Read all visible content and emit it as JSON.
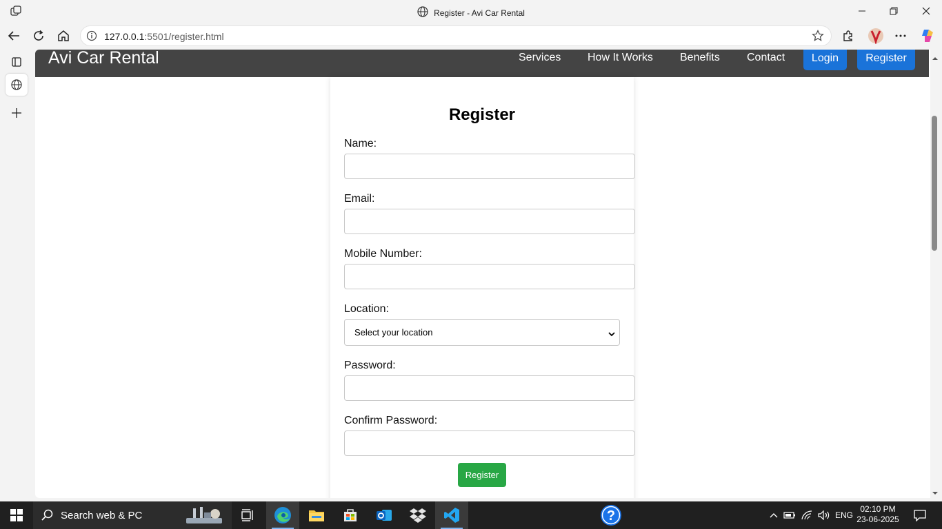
{
  "window": {
    "title": "Register - Avi Car Rental"
  },
  "browser": {
    "url_host": "127.0.0.1",
    "url_path": ":5501/register.html"
  },
  "site": {
    "brand": "Avi Car Rental",
    "nav": {
      "services": "Services",
      "how_it_works": "How It Works",
      "benefits": "Benefits",
      "contact": "Contact",
      "login": "Login",
      "register": "Register"
    }
  },
  "form": {
    "heading": "Register",
    "name_label": "Name:",
    "name_value": "",
    "email_label": "Email:",
    "email_value": "",
    "mobile_label": "Mobile Number:",
    "mobile_value": "",
    "location_label": "Location:",
    "location_selected": "Select your location",
    "password_label": "Password:",
    "password_value": "",
    "confirm_label": "Confirm Password:",
    "confirm_value": "",
    "submit_label": "Register"
  },
  "taskbar": {
    "search_text": "Search web & PC",
    "lang": "ENG",
    "time": "02:10 PM",
    "date": "23-06-2025"
  },
  "colors": {
    "header_bg": "#444444",
    "nav_button": "#1a73d9",
    "submit_button": "#28a745"
  }
}
